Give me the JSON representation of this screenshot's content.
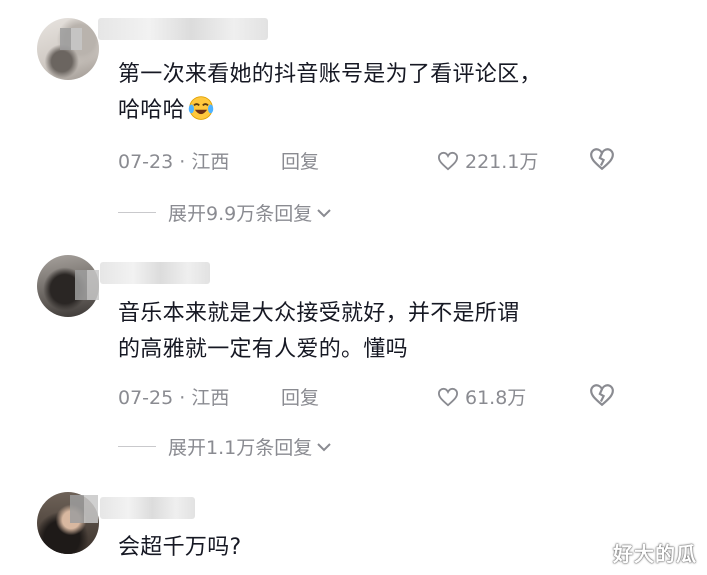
{
  "comments": [
    {
      "text_line1": "第一次来看她的抖音账号是为了看评论区，",
      "text_line2": "哈哈哈",
      "emoji": "laughing-tears-emoji",
      "date_location": "07-23 · 江西",
      "reply_label": "回复",
      "likes": "221.1万",
      "expand_label": "展开9.9万条回复"
    },
    {
      "text_line1": "音乐本来就是大众接受就好，并不是所谓",
      "text_line2": "的高雅就一定有人爱的。懂吗",
      "date_location": "07-25 · 江西",
      "reply_label": "回复",
      "likes": "61.8万",
      "expand_label": "展开1.1万条回复"
    },
    {
      "text_line1": "会超千万吗?"
    }
  ],
  "watermark": "好大的瓜",
  "icons": {
    "like": "heart-outline-icon",
    "dislike": "broken-heart-icon",
    "expand": "chevron-down-icon"
  },
  "colors": {
    "text": "#161823",
    "meta": "#8a8b91",
    "background": "#ffffff"
  }
}
